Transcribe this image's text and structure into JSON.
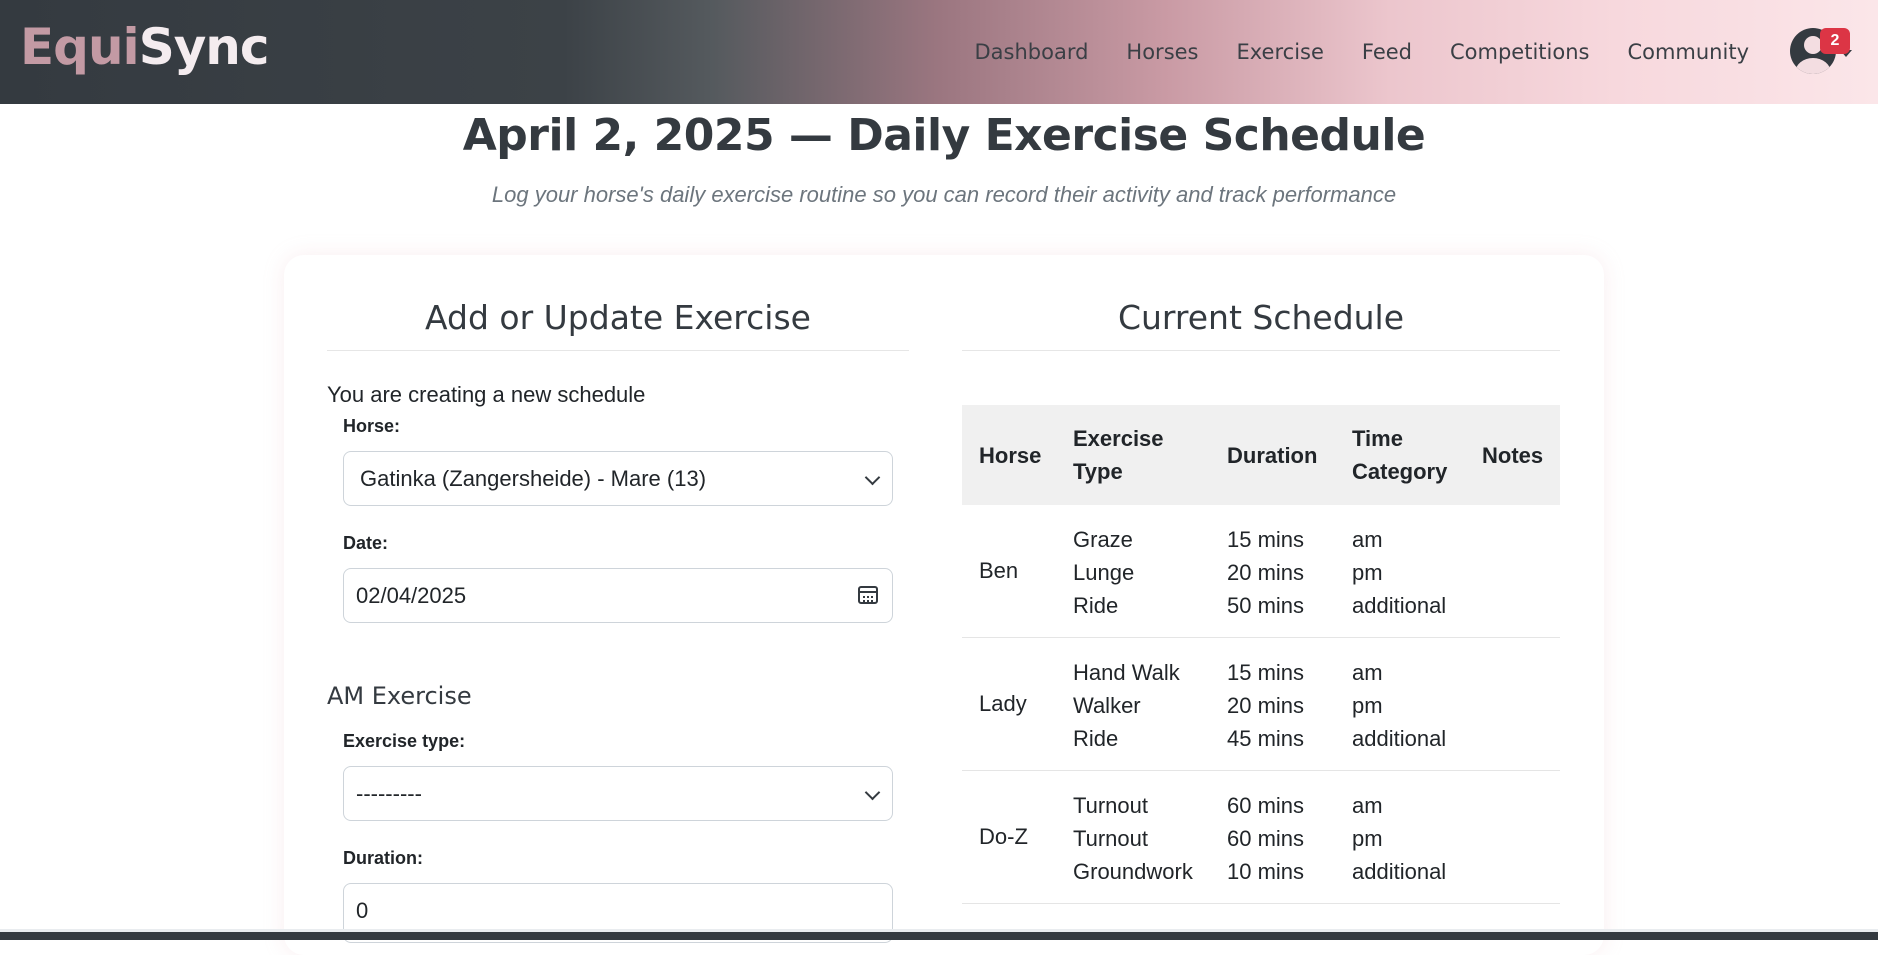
{
  "app": {
    "brand_part1": "Equi",
    "brand_part2": "Sync",
    "nav": [
      "Dashboard",
      "Horses",
      "Exercise",
      "Feed",
      "Competitions",
      "Community"
    ],
    "notification_count": "2"
  },
  "header": {
    "title": "April 2, 2025 — Daily Exercise Schedule",
    "subtitle": "Log your horse's daily exercise routine so you can record their activity and track performance"
  },
  "form": {
    "title": "Add or Update Exercise",
    "status": "You are creating a new schedule",
    "horse_label": "Horse:",
    "horse_value": "Gatinka (Zangersheide) - Mare (13)",
    "date_label": "Date:",
    "date_value": "02/04/2025",
    "am_heading": "AM Exercise",
    "exercise_type_label": "Exercise type:",
    "exercise_type_value": "---------",
    "duration_label": "Duration:",
    "duration_value": "0"
  },
  "schedule": {
    "title": "Current Schedule",
    "headers": {
      "horse": "Horse",
      "exercise_type_1": "Exercise",
      "exercise_type_2": "Type",
      "duration": "Duration",
      "time_category_1": "Time",
      "time_category_2": "Category",
      "notes": "Notes"
    },
    "rows": [
      {
        "horse": "Ben",
        "exercises": [
          "Graze",
          "Lunge",
          "Ride"
        ],
        "durations": [
          "15 mins",
          "20 mins",
          "50 mins"
        ],
        "times": [
          "am",
          "pm",
          "additional"
        ]
      },
      {
        "horse": "Lady",
        "exercises": [
          "Hand Walk",
          "Walker",
          "Ride"
        ],
        "durations": [
          "15 mins",
          "20 mins",
          "45 mins"
        ],
        "times": [
          "am",
          "pm",
          "additional"
        ]
      },
      {
        "horse": "Do-Z",
        "exercises": [
          "Turnout",
          "Turnout",
          "Groundwork"
        ],
        "durations": [
          "60 mins",
          "60 mins",
          "10 mins"
        ],
        "times": [
          "am",
          "pm",
          "additional"
        ]
      }
    ]
  },
  "colors": {
    "brand_accent": "#c39aa4",
    "badge": "#dc3545",
    "navbar_dark": "#343a40"
  }
}
